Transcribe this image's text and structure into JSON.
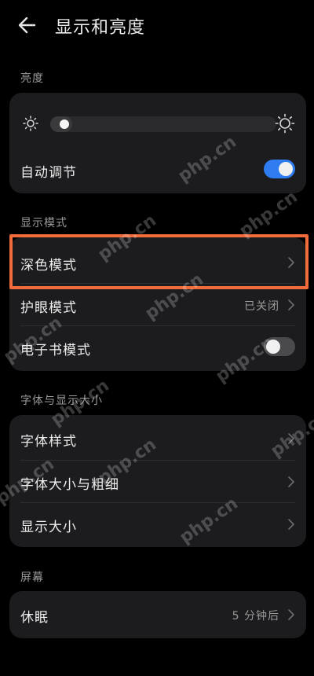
{
  "header": {
    "title": "显示和亮度"
  },
  "sections": {
    "brightness": "亮度",
    "display_mode": "显示模式",
    "font_size": "字体与显示大小",
    "screen": "屏幕"
  },
  "brightness": {
    "auto_adjust_label": "自动调节",
    "auto_adjust_on": true,
    "level": 0.03
  },
  "display_mode": {
    "dark_mode": "深色模式",
    "eye_comfort": "护眼模式",
    "eye_comfort_value": "已关闭",
    "ebook_mode": "电子书模式",
    "ebook_mode_on": false
  },
  "font": {
    "font_style": "字体样式",
    "font_size_weight": "字体大小与粗细",
    "display_size": "显示大小"
  },
  "screen": {
    "sleep": "休眠",
    "sleep_value": "5 分钟后"
  },
  "watermark": "php.cn",
  "colors": {
    "accent": "#2f7bf0",
    "highlight": "#f26b3a",
    "card": "#1c1c1e"
  }
}
